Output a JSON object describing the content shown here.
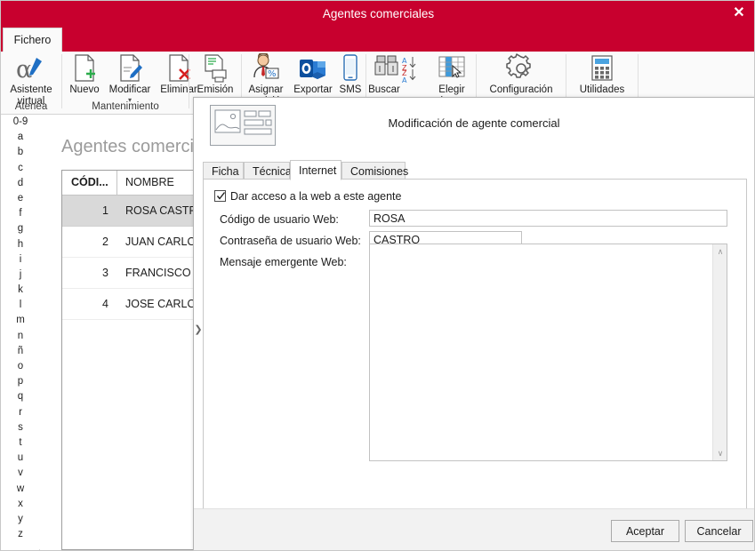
{
  "window": {
    "title": "Agentes comerciales",
    "close_label": "✕",
    "accent_color": "#c8002e"
  },
  "ribbon": {
    "file_tab": "Fichero",
    "groups": [
      {
        "label": "Atenea",
        "buttons": [
          {
            "label_line1": "Asistente",
            "label_line2": "virtual",
            "icon": "alpha-pen-icon",
            "caret": false
          }
        ]
      },
      {
        "label": "Mantenimiento",
        "buttons": [
          {
            "label_line1": "Nuevo",
            "label_line2": "",
            "icon": "new-document-icon",
            "caret": false
          },
          {
            "label_line1": "Modificar",
            "label_line2": "",
            "icon": "edit-document-icon",
            "caret": true
          },
          {
            "label_line1": "Eliminar",
            "label_line2": "",
            "icon": "delete-document-icon",
            "caret": false
          }
        ]
      },
      {
        "label": "",
        "buttons": [
          {
            "label_line1": "Emisión",
            "label_line2": "",
            "icon": "print-report-icon",
            "caret": false
          }
        ]
      },
      {
        "label": "",
        "buttons": [
          {
            "label_line1": "Asignar",
            "label_line2": "comisión",
            "icon": "assign-commission-icon",
            "caret": false
          },
          {
            "label_line1": "Exportar",
            "label_line2": "",
            "icon": "outlook-export-icon",
            "caret": false
          },
          {
            "label_line1": "SMS",
            "label_line2": "",
            "icon": "mobile-phone-icon",
            "caret": false
          }
        ]
      },
      {
        "label": "",
        "buttons": [
          {
            "label_line1": "Buscar",
            "label_line2": "",
            "icon": "binoculars-icon",
            "caret": false
          },
          {
            "label_line1": "Elegir",
            "label_line2": "columnas",
            "icon": "choose-columns-icon",
            "caret": false
          }
        ]
      },
      {
        "label": "",
        "buttons": [
          {
            "label_line1": "Configuración",
            "label_line2": "",
            "icon": "gear-icon",
            "caret": false
          }
        ]
      },
      {
        "label": "",
        "buttons": [
          {
            "label_line1": "Utilidades",
            "label_line2": "",
            "icon": "calculator-icon",
            "caret": true
          }
        ]
      }
    ]
  },
  "alphabet_rail": {
    "items": [
      "0-9",
      "a",
      "b",
      "c",
      "d",
      "e",
      "f",
      "g",
      "h",
      "i",
      "j",
      "k",
      "l",
      "m",
      "n",
      "ñ",
      "o",
      "p",
      "q",
      "r",
      "s",
      "t",
      "u",
      "v",
      "w",
      "x",
      "y",
      "z"
    ]
  },
  "main": {
    "page_title": "Agentes comerciales",
    "grid": {
      "columns": [
        "CÓDI...",
        "NOMBRE"
      ],
      "rows": [
        {
          "code": "1",
          "name": "ROSA CASTRO PA",
          "selected": true
        },
        {
          "code": "2",
          "name": "JUAN CARLOS RO",
          "selected": false
        },
        {
          "code": "3",
          "name": "FRANCISCO JOSE",
          "selected": false
        },
        {
          "code": "4",
          "name": "JOSE CARLOS RU",
          "selected": false
        }
      ]
    }
  },
  "dialog": {
    "title": "Modificación de agente comercial",
    "expander_glyph": "❯",
    "tabs": [
      {
        "label": "Ficha",
        "active": false
      },
      {
        "label": "Técnica",
        "active": false
      },
      {
        "label": "Internet",
        "active": true
      },
      {
        "label": "Comisiones",
        "active": false
      }
    ],
    "form": {
      "web_access_checkbox": {
        "label": "Dar acceso a la web a este agente",
        "checked": true
      },
      "user_code": {
        "label": "Código de usuario Web:",
        "value": "ROSA",
        "placeholder": ""
      },
      "password": {
        "label": "Contraseña de usuario Web:",
        "value": "CASTRO",
        "placeholder": ""
      },
      "popup_message": {
        "label": "Mensaje emergente Web:",
        "value": "",
        "placeholder": "",
        "scroll_up_glyph": "∧",
        "scroll_down_glyph": "∨"
      }
    },
    "footer": {
      "accept_label": "Aceptar",
      "cancel_label": "Cancelar"
    }
  }
}
